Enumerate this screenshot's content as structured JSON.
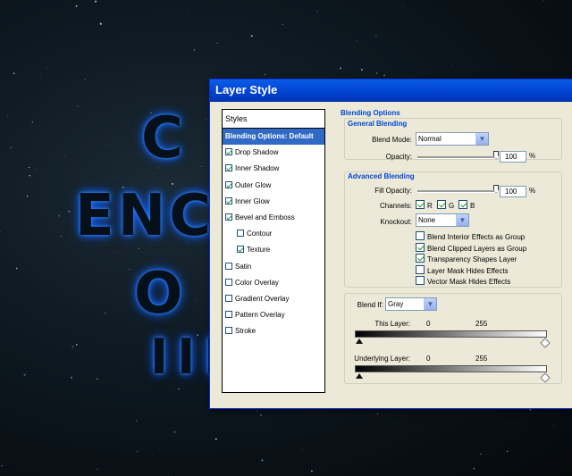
{
  "canvas": {
    "text_lines": [
      "C",
      "ENC",
      "O",
      "III"
    ]
  },
  "dialog": {
    "title": "Layer Style",
    "styles_panel": {
      "header": "Styles",
      "items": [
        {
          "label": "Blending Options: Default",
          "checked": null,
          "active": true,
          "sub": false
        },
        {
          "label": "Drop Shadow",
          "checked": true,
          "active": false,
          "sub": false
        },
        {
          "label": "Inner Shadow",
          "checked": true,
          "active": false,
          "sub": false
        },
        {
          "label": "Outer Glow",
          "checked": true,
          "active": false,
          "sub": false
        },
        {
          "label": "Inner Glow",
          "checked": true,
          "active": false,
          "sub": false
        },
        {
          "label": "Bevel and Emboss",
          "checked": true,
          "active": false,
          "sub": false
        },
        {
          "label": "Contour",
          "checked": false,
          "active": false,
          "sub": true
        },
        {
          "label": "Texture",
          "checked": true,
          "active": false,
          "sub": true
        },
        {
          "label": "Satin",
          "checked": false,
          "active": false,
          "sub": false
        },
        {
          "label": "Color Overlay",
          "checked": false,
          "active": false,
          "sub": false
        },
        {
          "label": "Gradient Overlay",
          "checked": false,
          "active": false,
          "sub": false
        },
        {
          "label": "Pattern Overlay",
          "checked": false,
          "active": false,
          "sub": false
        },
        {
          "label": "Stroke",
          "checked": false,
          "active": false,
          "sub": false
        }
      ]
    },
    "blending_options": {
      "title": "Blending Options",
      "general": {
        "title": "General Blending",
        "blend_mode_label": "Blend Mode:",
        "blend_mode_value": "Normal",
        "opacity_label": "Opacity:",
        "opacity_value": "100",
        "opacity_unit": "%",
        "opacity_level": 1.0
      },
      "advanced": {
        "title": "Advanced Blending",
        "fill_opacity_label": "Fill Opacity:",
        "fill_opacity_value": "100",
        "fill_opacity_unit": "%",
        "fill_opacity_level": 1.0,
        "channels_label": "Channels:",
        "channels": [
          {
            "label": "R",
            "checked": true
          },
          {
            "label": "G",
            "checked": true
          },
          {
            "label": "B",
            "checked": true
          }
        ],
        "knockout_label": "Knockout:",
        "knockout_value": "None",
        "options": [
          {
            "label": "Blend Interior Effects as Group",
            "checked": false
          },
          {
            "label": "Blend Clipped Layers as Group",
            "checked": true
          },
          {
            "label": "Transparency Shapes Layer",
            "checked": true
          },
          {
            "label": "Layer Mask Hides Effects",
            "checked": false
          },
          {
            "label": "Vector Mask Hides Effects",
            "checked": false
          }
        ]
      },
      "blend_if": {
        "label": "Blend If:",
        "value": "Gray",
        "this_layer_label": "This Layer:",
        "this_layer_min": "0",
        "this_layer_max": "255",
        "underlying_label": "Underlying Layer:",
        "underlying_min": "0",
        "underlying_max": "255"
      }
    }
  },
  "colors": {
    "accent": "#316ac5",
    "section_title": "#0046d5",
    "dialog_bg": "#ece9d8",
    "glow": "#1a6cff"
  }
}
